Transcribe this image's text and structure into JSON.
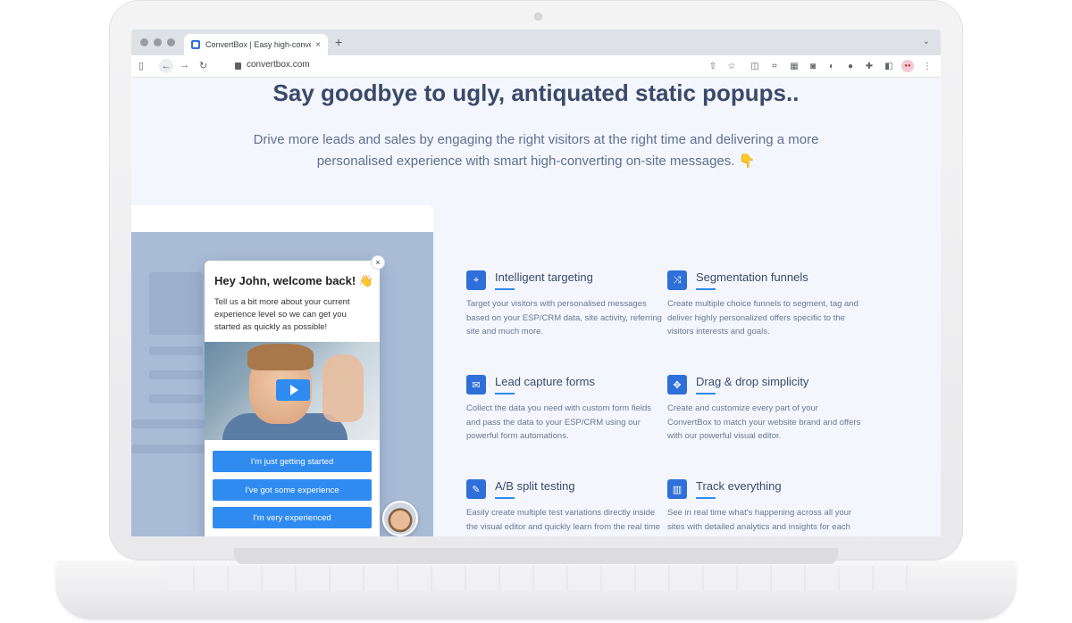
{
  "browser": {
    "tab_title": "ConvertBox | Easy high-conve",
    "tab_close": "×",
    "new_tab": "+",
    "url": "convertbox.com"
  },
  "hero": {
    "headline": "Say goodbye to ugly, antiquated static popups..",
    "subheadline": "Drive more leads and sales by engaging the right visitors at the right time and delivering a more personalised experience with smart high-converting on-site messages. 👇"
  },
  "popup": {
    "close": "×",
    "title": "Hey John, welcome back! 👋",
    "text": "Tell us a bit more about your current experience level so we can get you started as quickly as possible!",
    "buttons": [
      "I'm just getting started",
      "I've got some experience",
      "I'm very experienced"
    ]
  },
  "features": [
    {
      "title": "Intelligent targeting",
      "icon": "target-icon",
      "glyph": "⌖",
      "desc": "Target your visitors with personalised messages based on your ESP/CRM data, site activity, referring site and much more."
    },
    {
      "title": "Segmentation funnels",
      "icon": "shuffle-icon",
      "glyph": "⤨",
      "desc": "Create multiple choice funnels to segment, tag and deliver highly personalized offers specific to the visitors interests and goals."
    },
    {
      "title": "Lead capture forms",
      "icon": "envelope-icon",
      "glyph": "✉",
      "desc": "Collect the data you need with custom form fields and pass the data to your ESP/CRM using our powerful form automations."
    },
    {
      "title": "Drag & drop simplicity",
      "icon": "move-icon",
      "glyph": "✥",
      "desc": "Create and customize every part of your ConvertBox to match your website brand and offers with our powerful visual editor."
    },
    {
      "title": "A/B split testing",
      "icon": "pencil-icon",
      "glyph": "✎",
      "desc": "Easily create multiple test variations directly inside the visual editor and quickly learn from the real time data what converts the best."
    },
    {
      "title": "Track everything",
      "icon": "chart-icon",
      "glyph": "▥",
      "desc": "See in real time what's happening across all your sites with detailed analytics and insights for each element and step in your message."
    }
  ],
  "colors": {
    "accent": "#2f8bf0",
    "icon_bg": "#2f6fd9",
    "heading": "#3b4a6b",
    "page_bg": "#f3f6fc"
  }
}
